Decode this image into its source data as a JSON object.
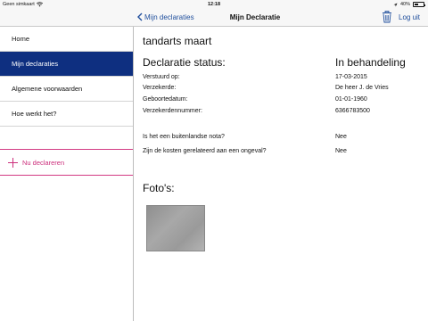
{
  "status_bar": {
    "carrier": "Geen simkaart",
    "time": "12:18",
    "battery": "40%",
    "battery_level": 0.4
  },
  "nav": {
    "back_label": "Mijn declaraties",
    "title": "Mijn Declaratie",
    "logout_label": "Log uit"
  },
  "sidebar": {
    "items": [
      {
        "label": "Home"
      },
      {
        "label": "Mijn declaraties"
      },
      {
        "label": "Algemene voorwaarden"
      },
      {
        "label": "Hoe werkt het?"
      }
    ],
    "add_label": "Nu declareren"
  },
  "declaration": {
    "title": "tandarts maart",
    "status_label": "Declaratie status:",
    "status_value": "In behandeling",
    "fields": [
      {
        "label": "Verstuurd op:",
        "value": "17-03-2015"
      },
      {
        "label": "Verzekerde:",
        "value": "De heer J. de Vries"
      },
      {
        "label": "Geboortedatum:",
        "value": "01-01-1960"
      },
      {
        "label": "Verzekerdennummer:",
        "value": "6366783500"
      }
    ],
    "questions": [
      {
        "label": "Is het een buitenlandse nota?",
        "value": "Nee"
      },
      {
        "label": "Zijn de kosten gerelateerd aan een ongeval?",
        "value": "Nee"
      }
    ],
    "photos_label": "Foto's:"
  },
  "colors": {
    "accent": "#1f4e9c",
    "active_sidebar": "#0e2f80",
    "add_pink": "#cc2f7c"
  }
}
